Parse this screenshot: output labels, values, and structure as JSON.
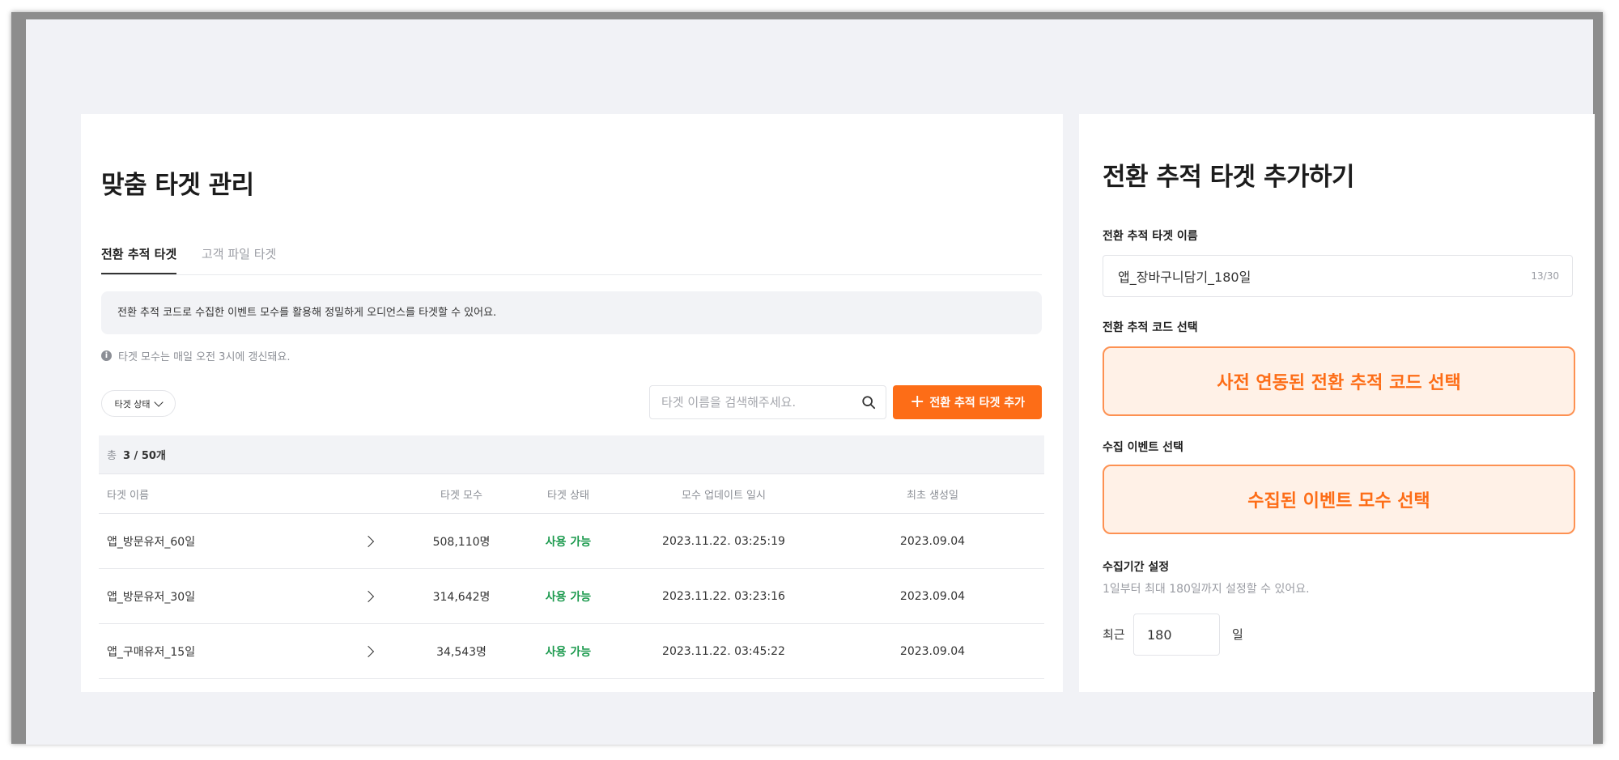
{
  "left": {
    "title": "맞춤 타겟 관리",
    "tabs": [
      {
        "label": "전환 추적 타겟",
        "active": true
      },
      {
        "label": "고객 파일 타겟",
        "active": false
      }
    ],
    "info_text": "전환 추적 코드로 수집한 이벤트 모수를 활용해 정밀하게 오디언스를 타겟할 수 있어요.",
    "note_text": "타겟 모수는 매일 오전 3시에 갱신돼요.",
    "status_filter_label": "타겟 상태",
    "search_placeholder": "타겟 이름을 검색해주세요.",
    "add_button_label": "전환 추적 타겟 추가",
    "table": {
      "count_prefix": "총",
      "count_value": "3 / 50개",
      "headers": [
        "타겟 이름",
        "타겟 모수",
        "타겟 상태",
        "모수 업데이트 일시",
        "최초 생성일"
      ],
      "rows": [
        {
          "name": "앱_방문유저_60일",
          "count": "508,110명",
          "status": "사용 가능",
          "updated": "2023.11.22. 03:25:19",
          "created": "2023.09.04"
        },
        {
          "name": "앱_방문유저_30일",
          "count": "314,642명",
          "status": "사용 가능",
          "updated": "2023.11.22. 03:23:16",
          "created": "2023.09.04"
        },
        {
          "name": "앱_구매유저_15일",
          "count": "34,543명",
          "status": "사용 가능",
          "updated": "2023.11.22. 03:45:22",
          "created": "2023.09.04"
        }
      ]
    }
  },
  "right": {
    "title": "전환 추적 타겟 추가하기",
    "name_label": "전환 추적 타겟 이름",
    "name_value": "앱_장바구니담기_180일",
    "name_char_count": "13/30",
    "code_label": "전환 추적 코드 선택",
    "code_button": "사전 연동된 전환 추적 코드 선택",
    "event_label": "수집 이벤트 선택",
    "event_button": "수집된 이벤트 모수 선택",
    "period_label": "수집기간 설정",
    "period_help": "1일부터 최대 180일까지 설정할 수 있어요.",
    "recent_label": "최근",
    "days_value": "180",
    "days_unit": "일"
  },
  "colors": {
    "accent": "#fd6d17",
    "accent_light": "#fff1e7",
    "status_ok": "#1c9a4e",
    "background": "#f1f2f6"
  }
}
